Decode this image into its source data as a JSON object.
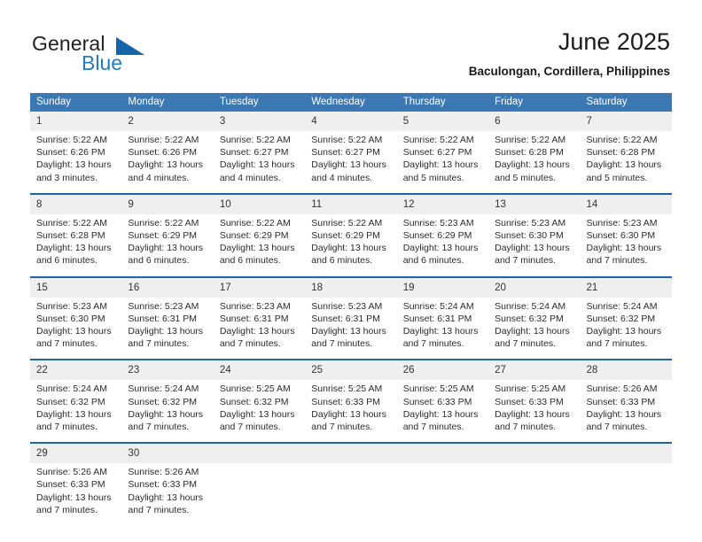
{
  "logo": {
    "word_one": "General",
    "word_two": "Blue",
    "triangle_color": "#1464aa",
    "blue_text_color": "#1f7cc4"
  },
  "header": {
    "title": "June 2025",
    "subtitle": "Baculongan, Cordillera, Philippines"
  },
  "theme": {
    "header_blue": "#3b78b4",
    "row_divider_blue": "#1f63ad",
    "daynum_band": "#efefef"
  },
  "calendar": {
    "weekday_headers": [
      "Sunday",
      "Monday",
      "Tuesday",
      "Wednesday",
      "Thursday",
      "Friday",
      "Saturday"
    ],
    "weeks": [
      [
        {
          "day": "1",
          "sunrise": "Sunrise: 5:22 AM",
          "sunset": "Sunset: 6:26 PM",
          "daylight_line1": "Daylight: 13 hours",
          "daylight_line2": "and 3 minutes."
        },
        {
          "day": "2",
          "sunrise": "Sunrise: 5:22 AM",
          "sunset": "Sunset: 6:26 PM",
          "daylight_line1": "Daylight: 13 hours",
          "daylight_line2": "and 4 minutes."
        },
        {
          "day": "3",
          "sunrise": "Sunrise: 5:22 AM",
          "sunset": "Sunset: 6:27 PM",
          "daylight_line1": "Daylight: 13 hours",
          "daylight_line2": "and 4 minutes."
        },
        {
          "day": "4",
          "sunrise": "Sunrise: 5:22 AM",
          "sunset": "Sunset: 6:27 PM",
          "daylight_line1": "Daylight: 13 hours",
          "daylight_line2": "and 4 minutes."
        },
        {
          "day": "5",
          "sunrise": "Sunrise: 5:22 AM",
          "sunset": "Sunset: 6:27 PM",
          "daylight_line1": "Daylight: 13 hours",
          "daylight_line2": "and 5 minutes."
        },
        {
          "day": "6",
          "sunrise": "Sunrise: 5:22 AM",
          "sunset": "Sunset: 6:28 PM",
          "daylight_line1": "Daylight: 13 hours",
          "daylight_line2": "and 5 minutes."
        },
        {
          "day": "7",
          "sunrise": "Sunrise: 5:22 AM",
          "sunset": "Sunset: 6:28 PM",
          "daylight_line1": "Daylight: 13 hours",
          "daylight_line2": "and 5 minutes."
        }
      ],
      [
        {
          "day": "8",
          "sunrise": "Sunrise: 5:22 AM",
          "sunset": "Sunset: 6:28 PM",
          "daylight_line1": "Daylight: 13 hours",
          "daylight_line2": "and 6 minutes."
        },
        {
          "day": "9",
          "sunrise": "Sunrise: 5:22 AM",
          "sunset": "Sunset: 6:29 PM",
          "daylight_line1": "Daylight: 13 hours",
          "daylight_line2": "and 6 minutes."
        },
        {
          "day": "10",
          "sunrise": "Sunrise: 5:22 AM",
          "sunset": "Sunset: 6:29 PM",
          "daylight_line1": "Daylight: 13 hours",
          "daylight_line2": "and 6 minutes."
        },
        {
          "day": "11",
          "sunrise": "Sunrise: 5:22 AM",
          "sunset": "Sunset: 6:29 PM",
          "daylight_line1": "Daylight: 13 hours",
          "daylight_line2": "and 6 minutes."
        },
        {
          "day": "12",
          "sunrise": "Sunrise: 5:23 AM",
          "sunset": "Sunset: 6:29 PM",
          "daylight_line1": "Daylight: 13 hours",
          "daylight_line2": "and 6 minutes."
        },
        {
          "day": "13",
          "sunrise": "Sunrise: 5:23 AM",
          "sunset": "Sunset: 6:30 PM",
          "daylight_line1": "Daylight: 13 hours",
          "daylight_line2": "and 7 minutes."
        },
        {
          "day": "14",
          "sunrise": "Sunrise: 5:23 AM",
          "sunset": "Sunset: 6:30 PM",
          "daylight_line1": "Daylight: 13 hours",
          "daylight_line2": "and 7 minutes."
        }
      ],
      [
        {
          "day": "15",
          "sunrise": "Sunrise: 5:23 AM",
          "sunset": "Sunset: 6:30 PM",
          "daylight_line1": "Daylight: 13 hours",
          "daylight_line2": "and 7 minutes."
        },
        {
          "day": "16",
          "sunrise": "Sunrise: 5:23 AM",
          "sunset": "Sunset: 6:31 PM",
          "daylight_line1": "Daylight: 13 hours",
          "daylight_line2": "and 7 minutes."
        },
        {
          "day": "17",
          "sunrise": "Sunrise: 5:23 AM",
          "sunset": "Sunset: 6:31 PM",
          "daylight_line1": "Daylight: 13 hours",
          "daylight_line2": "and 7 minutes."
        },
        {
          "day": "18",
          "sunrise": "Sunrise: 5:23 AM",
          "sunset": "Sunset: 6:31 PM",
          "daylight_line1": "Daylight: 13 hours",
          "daylight_line2": "and 7 minutes."
        },
        {
          "day": "19",
          "sunrise": "Sunrise: 5:24 AM",
          "sunset": "Sunset: 6:31 PM",
          "daylight_line1": "Daylight: 13 hours",
          "daylight_line2": "and 7 minutes."
        },
        {
          "day": "20",
          "sunrise": "Sunrise: 5:24 AM",
          "sunset": "Sunset: 6:32 PM",
          "daylight_line1": "Daylight: 13 hours",
          "daylight_line2": "and 7 minutes."
        },
        {
          "day": "21",
          "sunrise": "Sunrise: 5:24 AM",
          "sunset": "Sunset: 6:32 PM",
          "daylight_line1": "Daylight: 13 hours",
          "daylight_line2": "and 7 minutes."
        }
      ],
      [
        {
          "day": "22",
          "sunrise": "Sunrise: 5:24 AM",
          "sunset": "Sunset: 6:32 PM",
          "daylight_line1": "Daylight: 13 hours",
          "daylight_line2": "and 7 minutes."
        },
        {
          "day": "23",
          "sunrise": "Sunrise: 5:24 AM",
          "sunset": "Sunset: 6:32 PM",
          "daylight_line1": "Daylight: 13 hours",
          "daylight_line2": "and 7 minutes."
        },
        {
          "day": "24",
          "sunrise": "Sunrise: 5:25 AM",
          "sunset": "Sunset: 6:32 PM",
          "daylight_line1": "Daylight: 13 hours",
          "daylight_line2": "and 7 minutes."
        },
        {
          "day": "25",
          "sunrise": "Sunrise: 5:25 AM",
          "sunset": "Sunset: 6:33 PM",
          "daylight_line1": "Daylight: 13 hours",
          "daylight_line2": "and 7 minutes."
        },
        {
          "day": "26",
          "sunrise": "Sunrise: 5:25 AM",
          "sunset": "Sunset: 6:33 PM",
          "daylight_line1": "Daylight: 13 hours",
          "daylight_line2": "and 7 minutes."
        },
        {
          "day": "27",
          "sunrise": "Sunrise: 5:25 AM",
          "sunset": "Sunset: 6:33 PM",
          "daylight_line1": "Daylight: 13 hours",
          "daylight_line2": "and 7 minutes."
        },
        {
          "day": "28",
          "sunrise": "Sunrise: 5:26 AM",
          "sunset": "Sunset: 6:33 PM",
          "daylight_line1": "Daylight: 13 hours",
          "daylight_line2": "and 7 minutes."
        }
      ],
      [
        {
          "day": "29",
          "sunrise": "Sunrise: 5:26 AM",
          "sunset": "Sunset: 6:33 PM",
          "daylight_line1": "Daylight: 13 hours",
          "daylight_line2": "and 7 minutes."
        },
        {
          "day": "30",
          "sunrise": "Sunrise: 5:26 AM",
          "sunset": "Sunset: 6:33 PM",
          "daylight_line1": "Daylight: 13 hours",
          "daylight_line2": "and 7 minutes."
        },
        {
          "day": "",
          "sunrise": "",
          "sunset": "",
          "daylight_line1": "",
          "daylight_line2": ""
        },
        {
          "day": "",
          "sunrise": "",
          "sunset": "",
          "daylight_line1": "",
          "daylight_line2": ""
        },
        {
          "day": "",
          "sunrise": "",
          "sunset": "",
          "daylight_line1": "",
          "daylight_line2": ""
        },
        {
          "day": "",
          "sunrise": "",
          "sunset": "",
          "daylight_line1": "",
          "daylight_line2": ""
        },
        {
          "day": "",
          "sunrise": "",
          "sunset": "",
          "daylight_line1": "",
          "daylight_line2": ""
        }
      ]
    ]
  }
}
